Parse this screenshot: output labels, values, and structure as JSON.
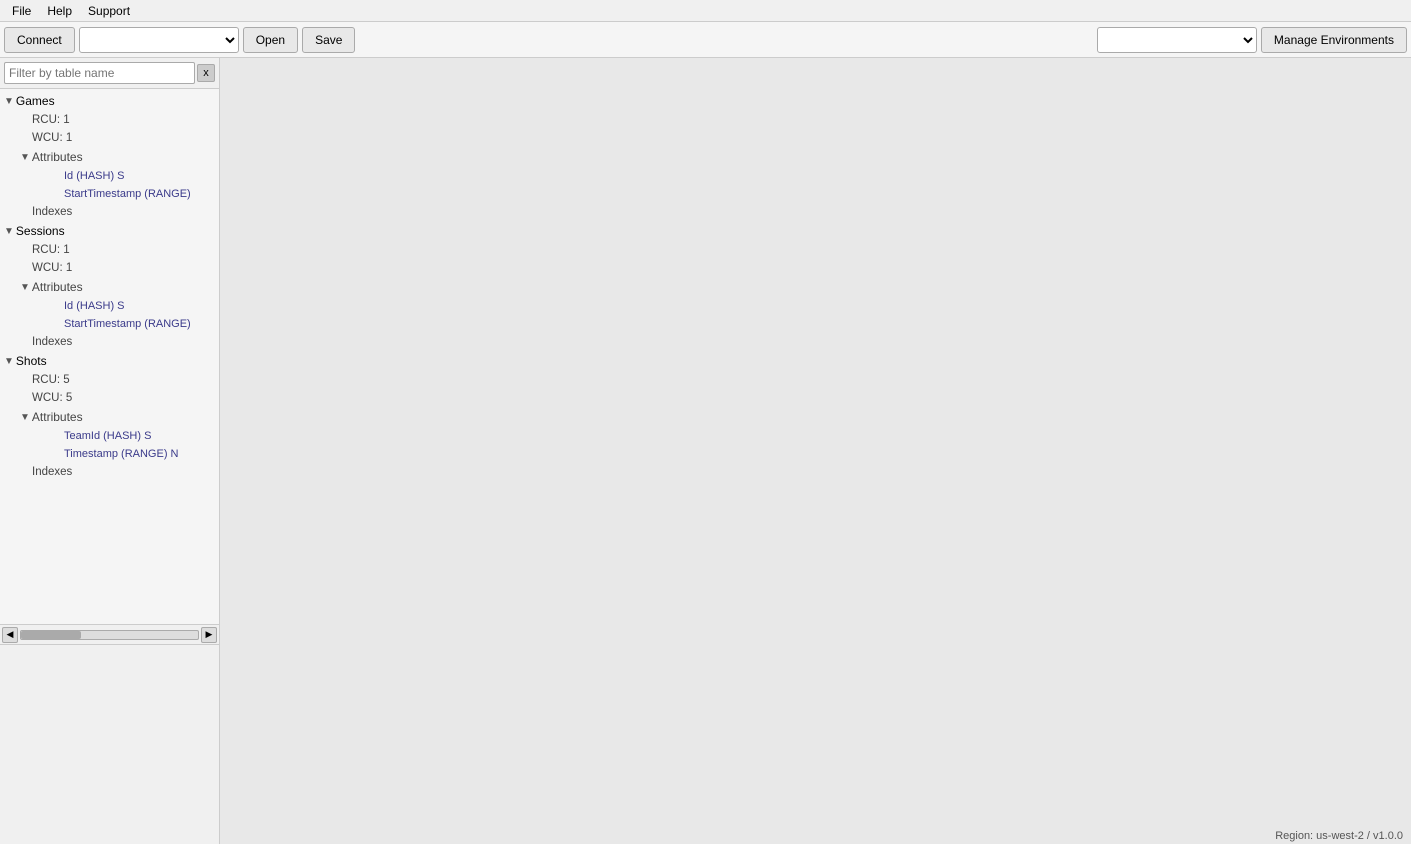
{
  "menubar": {
    "items": [
      {
        "id": "file",
        "label": "File"
      },
      {
        "id": "help",
        "label": "Help"
      },
      {
        "id": "support",
        "label": "Support"
      }
    ]
  },
  "toolbar": {
    "connect_label": "Connect",
    "open_label": "Open",
    "save_label": "Save",
    "manage_label": "Manage Environments",
    "table_select_placeholder": "",
    "region_select_placeholder": ""
  },
  "sidebar": {
    "filter_placeholder": "Filter by table name",
    "filter_clear": "x",
    "tables": [
      {
        "name": "Games",
        "expanded": true,
        "rcu": "RCU: 1",
        "wcu": "WCU: 1",
        "attributes_expanded": true,
        "attributes": [
          "Id (HASH) S",
          "StartTimestamp (RANGE)"
        ],
        "indexes": "Indexes"
      },
      {
        "name": "Sessions",
        "expanded": true,
        "rcu": "RCU: 1",
        "wcu": "WCU: 1",
        "attributes_expanded": true,
        "attributes": [
          "Id (HASH) S",
          "StartTimestamp (RANGE)"
        ],
        "indexes": "Indexes"
      },
      {
        "name": "Shots",
        "expanded": true,
        "rcu": "RCU: 5",
        "wcu": "WCU: 5",
        "attributes_expanded": true,
        "attributes": [
          "TeamId (HASH) S",
          "Timestamp (RANGE) N"
        ],
        "indexes": "Indexes"
      }
    ]
  },
  "statusbar": {
    "text": "Region: us-west-2 / v1.0.0"
  }
}
